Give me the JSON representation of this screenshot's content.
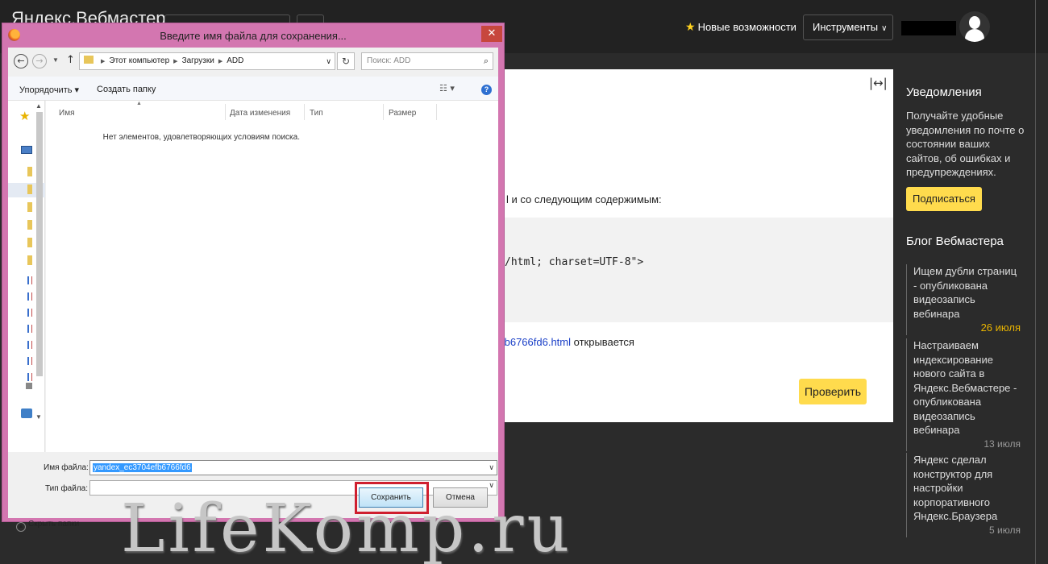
{
  "webmaster": {
    "header": {
      "logo_text": "Яндекс.Вебмастер",
      "add_button": "+",
      "features": "Новые возможности",
      "tools": "Инструменты"
    },
    "expand_icon": "expand-horizontal-icon",
    "content": {
      "line1": "l и со следующим содержимым:",
      "code": "/html; charset=UTF-8\">",
      "link_text": "fb6766fd6.html",
      "link_suffix": " открывается",
      "verify_button": "Проверить"
    },
    "sidebar": {
      "notifications_title": "Уведомления",
      "notifications_text": "Получайте удобные уведомления по почте о состоянии ваших сайтов, об ошибках и предупреждениях.",
      "subscribe_button": "Подписаться",
      "blog_title": "Блог Вебмастера",
      "posts": [
        {
          "title": "Ищем дубли страниц - опубликована видеозапись вебинара",
          "date": "26 июля"
        },
        {
          "title": "Настраиваем индексирование нового сайта в Яндекс.Вебмастере - опубликована видеозапись вебинара",
          "date": "13 июля"
        },
        {
          "title": "Яндекс сделал конструктор для настройки корпоративного Яндекс.Браузера",
          "date": "5 июля"
        }
      ]
    }
  },
  "dialog": {
    "title": "Введите имя файла для сохранения...",
    "close": "✕",
    "path": [
      "Этот компьютер",
      "Загрузки",
      "ADD"
    ],
    "search_placeholder": "Поиск: ADD",
    "organize": "Упорядочить ▾",
    "new_folder": "Создать папку",
    "columns": [
      "Имя",
      "Дата изменения",
      "Тип",
      "Размер"
    ],
    "empty_message": "Нет элементов, удовлетворяющих условиям поиска.",
    "file_name_label": "Имя файла:",
    "file_name_value": "yandex_ec3704efb6766fd6",
    "file_type_label": "Тип файла:",
    "file_type_value": "",
    "hide_folders": "Скрыть папки",
    "save_button": "Сохранить",
    "cancel_button": "Отмена"
  },
  "watermark": "LifeKomp.ru",
  "colors": {
    "accent_yellow": "#ffdb4d",
    "dialog_frame": "#d376b0",
    "highlight_red": "#cf1f2f",
    "page_bg": "#2b2b2b"
  }
}
